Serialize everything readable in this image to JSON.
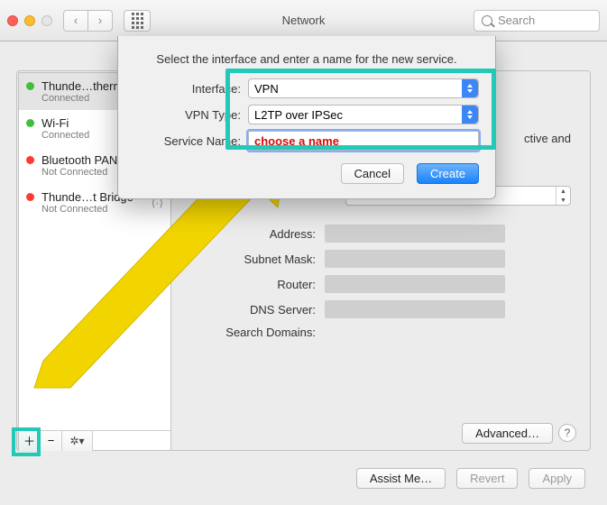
{
  "window": {
    "title": "Network",
    "search_placeholder": "Search"
  },
  "sidebar": {
    "items": [
      {
        "name": "Thunde…therm",
        "status": "Connected",
        "color": "green"
      },
      {
        "name": "Wi-Fi",
        "status": "Connected",
        "color": "green"
      },
      {
        "name": "Bluetooth PAN",
        "status": "Not Connected",
        "color": "red"
      },
      {
        "name": "Thunde…t Bridge",
        "status": "Not Connected",
        "color": "red"
      }
    ]
  },
  "details": {
    "truncated_text": "ctive and",
    "labels": {
      "address": "Address:",
      "subnet": "Subnet Mask:",
      "router": "Router:",
      "dns": "DNS Server:",
      "search_domains": "Search Domains:"
    }
  },
  "buttons": {
    "advanced": "Advanced…",
    "assist": "Assist Me…",
    "revert": "Revert",
    "apply": "Apply",
    "help": "?"
  },
  "sheet": {
    "message": "Select the interface and enter a name for the new service.",
    "labels": {
      "interface": "Interface:",
      "vpn_type": "VPN Type:",
      "service_name": "Service Name:"
    },
    "interface_value": "VPN",
    "vpn_type_value": "L2TP over IPSec",
    "service_name_value": "choose a name",
    "cancel": "Cancel",
    "create": "Create"
  }
}
